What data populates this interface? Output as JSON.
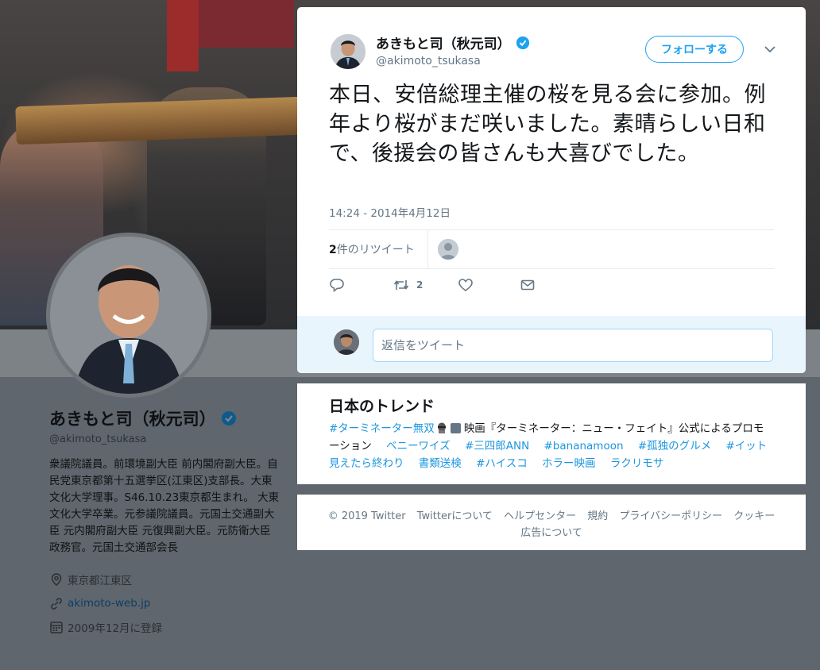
{
  "profile": {
    "name": "あきもと司（秋元司）",
    "handle": "@akimoto_tsukasa",
    "bio": "衆議院議員。前環境副大臣 前内閣府副大臣。自民党東京都第十五選挙区(江東区)支部長。大東文化大学理事。S46.10.23東京都生まれ。 大東文化大学卒業。元参議院議員。元国土交通副大臣 元内閣府副大臣 元復興副大臣。元防衛大臣政務官。元国土交通部会長",
    "location": "東京都江東区",
    "website": "akimoto-web.jp",
    "joined": "2009年12月に登録"
  },
  "tweet": {
    "author_name": "あきもと司（秋元司）",
    "author_handle": "@akimoto_tsukasa",
    "follow_label": "フォローする",
    "text": "本日、安倍総理主催の桜を見る会に参加。例年より桜がまだ咲いました。素晴らしい日和で、後援会の皆さんも大喜びでした。",
    "timestamp": "14:24 - 2014年4月12日",
    "retweet_count": "2",
    "retweet_label": "件のリツイート",
    "retweet_action_count": "2",
    "reply_placeholder": "返信をツイート"
  },
  "trends": {
    "title": "日本のトレンド",
    "items": [
      "#ターミネーター無双",
      "映画『ターミネーター：ニュー・フェイト』公式によるプロモーション",
      "ベニーワイズ",
      "#三四郎ANN",
      "#bananamoon",
      "#孤独のグルメ",
      "#イット見えたら終わり",
      "書類送検",
      "#ハイスコ",
      "ホラー映画",
      "ラクリモサ"
    ]
  },
  "footer": {
    "links_line1": [
      "© 2019 Twitter",
      "Twitterについて",
      "ヘルプセンター",
      "規約",
      "プライバシーポリシー",
      "クッキー"
    ],
    "links_line2": [
      "広告について"
    ]
  },
  "colors": {
    "accent": "#1da1f2",
    "link": "#1b95e0",
    "muted_text": "#657786",
    "overlay": "#5f666d"
  },
  "icons": [
    "verified-icon",
    "chevron-down-icon",
    "reply-icon",
    "retweet-icon",
    "like-icon",
    "dm-icon",
    "location-icon",
    "link-icon",
    "calendar-icon",
    "promoted-icon"
  ]
}
